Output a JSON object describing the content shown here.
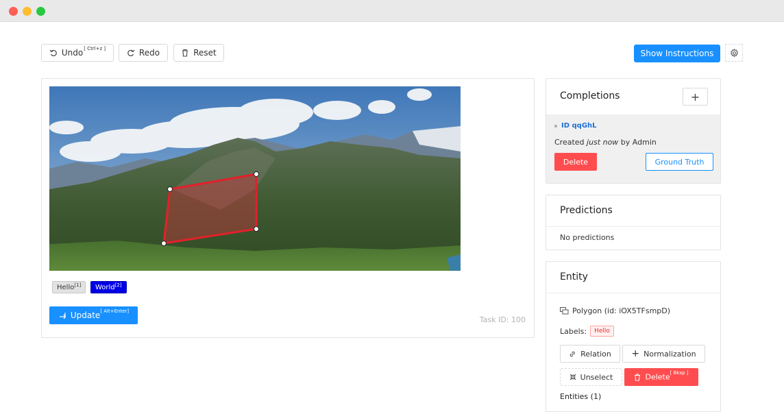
{
  "toolbar": {
    "undo_label": "Undo",
    "undo_shortcut": "[ Ctrl+z ]",
    "redo_label": "Redo",
    "reset_label": "Reset",
    "instructions_label": "Show Instructions"
  },
  "main": {
    "labels": [
      {
        "text": "Hello",
        "hotkey": "[1]"
      },
      {
        "text": "World",
        "hotkey": "[2]"
      }
    ],
    "update_label": "Update",
    "update_shortcut": "[ Alt+Enter]",
    "task_id": "Task ID: 100"
  },
  "completions": {
    "title": "Completions",
    "add_symbol": "+",
    "id_text": "ID qqGhL",
    "created_prefix": "Created ",
    "created_time": "just now",
    "created_suffix": " by Admin",
    "delete_label": "Delete",
    "ground_truth_label": "Ground Truth"
  },
  "predictions": {
    "title": "Predictions",
    "empty_text": "No predictions"
  },
  "entity": {
    "title": "Entity",
    "region_text": "Polygon (id: iOX5TFsmpD)",
    "labels_prefix": "Labels:",
    "label_badge": "Hello",
    "relation_label": "Relation",
    "normalization_label": "Normalization",
    "unselect_label": "Unselect",
    "delete_label": "Delete",
    "delete_shortcut": "[ Bksp ]",
    "entities_label": "Entities (1)"
  },
  "colors": {
    "primary": "#1890ff",
    "danger": "#ff4d4f",
    "polygon_stroke": "#e3202b",
    "label_world": "#0000e6"
  }
}
